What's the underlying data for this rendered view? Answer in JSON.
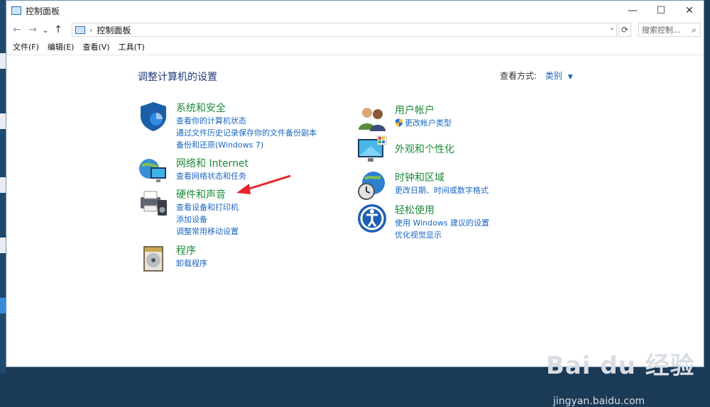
{
  "window": {
    "title": "控制面板",
    "controls": {
      "minimize": "—",
      "maximize": "☐",
      "close": "✕"
    }
  },
  "navbar": {
    "back": "←",
    "forward": "→",
    "recent": "⌄",
    "up": "↑",
    "address": "控制面板",
    "search_placeholder": "搜索控制..."
  },
  "menu": [
    "文件(F)",
    "编辑(E)",
    "查看(V)",
    "工具(T)"
  ],
  "page": {
    "heading": "调整计算机的设置",
    "view_by_label": "查看方式:",
    "view_by_value": "类别"
  },
  "categories": {
    "system_security": {
      "title": "系统和安全",
      "links": [
        "查看你的计算机状态",
        "通过文件历史记录保存你的文件备份副本",
        "备份和还原(Windows 7)"
      ]
    },
    "network": {
      "title": "网络和 Internet",
      "links": [
        "查看网络状态和任务"
      ]
    },
    "hardware_sound": {
      "title": "硬件和声音",
      "links": [
        "查看设备和打印机",
        "添加设备",
        "调整常用移动设置"
      ]
    },
    "programs": {
      "title": "程序",
      "links": [
        "卸载程序"
      ]
    },
    "user_accounts": {
      "title": "用户帐户",
      "links": [
        "更改帐户类型"
      ]
    },
    "appearance": {
      "title": "外观和个性化",
      "links": []
    },
    "clock_region": {
      "title": "时钟和区域",
      "links": [
        "更改日期、时间或数字格式"
      ]
    },
    "ease_of_access": {
      "title": "轻松使用",
      "links": [
        "使用 Windows 建议的设置",
        "优化视觉显示"
      ]
    }
  },
  "watermark": {
    "text": "Bai du 经验",
    "sub": "jingyan.baidu.com"
  },
  "colors": {
    "link": "#1a66c2",
    "category": "#1e8a3a",
    "heading": "#1e3a78",
    "annotation_arrow": "#e8252a"
  }
}
